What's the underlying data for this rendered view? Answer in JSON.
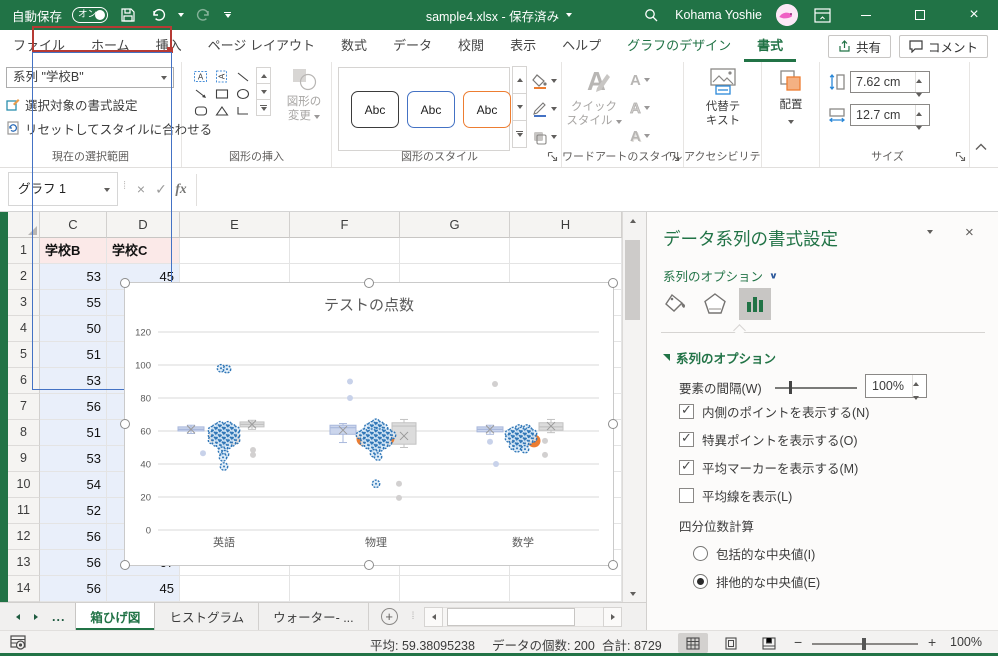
{
  "titlebar": {
    "autosave_label": "自動保存",
    "autosave_state": "オン",
    "title": "sample4.xlsx - 保存済み",
    "user": "Kohama Yoshie"
  },
  "ribbon_tabs": [
    {
      "label": "ファイル",
      "ctx": false,
      "active": false
    },
    {
      "label": "ホーム",
      "ctx": false,
      "active": false
    },
    {
      "label": "挿入",
      "ctx": false,
      "active": false
    },
    {
      "label": "ページ レイアウト",
      "ctx": false,
      "active": false
    },
    {
      "label": "数式",
      "ctx": false,
      "active": false
    },
    {
      "label": "データ",
      "ctx": false,
      "active": false
    },
    {
      "label": "校閲",
      "ctx": false,
      "active": false
    },
    {
      "label": "表示",
      "ctx": false,
      "active": false
    },
    {
      "label": "ヘルプ",
      "ctx": false,
      "active": false
    },
    {
      "label": "グラフのデザイン",
      "ctx": true,
      "active": false
    },
    {
      "label": "書式",
      "ctx": true,
      "active": true
    }
  ],
  "topbar_buttons": {
    "share": "共有",
    "comment": "コメント"
  },
  "ribbon": {
    "current_selection": {
      "label": "現在の選択範囲",
      "dropdown": "系列 \"学校B\"",
      "format_selection": "選択対象の書式設定",
      "reset": "リセットしてスタイルに合わせる"
    },
    "insert_shapes": {
      "label": "図形の挿入",
      "change_l1": "図形の",
      "change_l2": "変更"
    },
    "shape_styles": {
      "label": "図形のスタイル",
      "samples": [
        "Abc",
        "Abc",
        "Abc"
      ]
    },
    "wordart": {
      "label": "ワードアートのスタイル",
      "quick_l1": "クイック",
      "quick_l2": "スタイル"
    },
    "accessibility": {
      "label": "アクセシビリティ",
      "alt_l1": "代替テ",
      "alt_l2": "キスト"
    },
    "arrange": {
      "label": "配置"
    },
    "size": {
      "label": "サイズ",
      "height": "7.62 cm",
      "width": "12.7 cm"
    }
  },
  "formula_bar": {
    "name_box": "グラフ 1",
    "fx": "fx",
    "formula": ""
  },
  "grid": {
    "columns": [
      "C",
      "D",
      "E",
      "F",
      "G",
      "H"
    ],
    "rows": [
      {
        "n": "1",
        "c": "学校B",
        "d": "学校C",
        "header": true
      },
      {
        "n": "2",
        "c": "53",
        "d": "45"
      },
      {
        "n": "3",
        "c": "55",
        "d": ""
      },
      {
        "n": "4",
        "c": "50",
        "d": ""
      },
      {
        "n": "5",
        "c": "51",
        "d": ""
      },
      {
        "n": "6",
        "c": "53",
        "d": ""
      },
      {
        "n": "7",
        "c": "56",
        "d": ""
      },
      {
        "n": "8",
        "c": "51",
        "d": ""
      },
      {
        "n": "9",
        "c": "53",
        "d": ""
      },
      {
        "n": "10",
        "c": "54",
        "d": ""
      },
      {
        "n": "11",
        "c": "52",
        "d": ""
      },
      {
        "n": "12",
        "c": "56",
        "d": ""
      },
      {
        "n": "13",
        "c": "56",
        "d": "67"
      },
      {
        "n": "14",
        "c": "56",
        "d": "45"
      }
    ]
  },
  "chart": {
    "type": "box",
    "title": "テストの点数",
    "categories": [
      "英語",
      "物理",
      "数学"
    ],
    "ylim": [
      0,
      120
    ],
    "yticks": [
      0,
      20,
      40,
      60,
      80,
      100,
      120
    ],
    "series": [
      {
        "id": "a",
        "kind": "box",
        "fill": "#cbd5ec",
        "stroke": "#a9b8dc",
        "boxes": [
          {
            "lo": 58.5,
            "q1": 60,
            "med": 61,
            "q3": 62.5,
            "hi": 63.5,
            "mean": 61
          },
          {
            "lo": 53,
            "q1": 58,
            "med": 62,
            "q3": 63.5,
            "hi": 64.5,
            "mean": 60.5
          },
          {
            "lo": 58,
            "q1": 59.5,
            "med": 61,
            "q3": 62.5,
            "hi": 63.5,
            "mean": 61
          }
        ],
        "outliers": [
          [
            [
              -21,
              46.5
            ]
          ],
          [
            [
              -26,
              90
            ],
            [
              -26,
              80
            ]
          ],
          [
            [
              -33,
              53.5
            ],
            [
              -27,
              40
            ]
          ]
        ]
      },
      {
        "id": "b",
        "label": "学校B",
        "kind": "points",
        "selected": true,
        "ring": "#2e75b6",
        "fill": "#dcebf8",
        "mean_color": "#ed7d31",
        "clusters": [
          [
            [
              -3,
              98
            ],
            [
              3,
              97.5
            ],
            [
              -4,
              63.5
            ],
            [
              4,
              63.5
            ],
            [
              -8,
              62
            ],
            [
              0,
              62
            ],
            [
              8,
              62
            ],
            [
              -12,
              60.5
            ],
            [
              -4,
              60.5
            ],
            [
              4,
              60.5
            ],
            [
              12,
              60.5
            ],
            [
              -8,
              59
            ],
            [
              0,
              59
            ],
            [
              8,
              59
            ],
            [
              -12,
              57.5
            ],
            [
              -4,
              57.5
            ],
            [
              4,
              57.5
            ],
            [
              12,
              57.5
            ],
            [
              -8,
              56
            ],
            [
              0,
              56
            ],
            [
              8,
              56
            ],
            [
              -12,
              54.5
            ],
            [
              -4,
              54.5
            ],
            [
              4,
              54.5
            ],
            [
              12,
              54.5
            ],
            [
              -8,
              53
            ],
            [
              0,
              53
            ],
            [
              8,
              53
            ],
            [
              -4,
              51.5
            ],
            [
              4,
              51.5
            ],
            [
              0,
              50
            ],
            [
              -2,
              48
            ],
            [
              1,
              46
            ],
            [
              -1,
              44
            ],
            [
              0,
              38.5
            ]
          ],
          [
            [
              0,
              65
            ],
            [
              -4,
              63.5
            ],
            [
              4,
              63.5
            ],
            [
              -8,
              62
            ],
            [
              0,
              62
            ],
            [
              8,
              62
            ],
            [
              -4,
              60.5
            ],
            [
              4,
              60.5
            ],
            [
              -12,
              59
            ],
            [
              -4,
              59
            ],
            [
              4,
              59
            ],
            [
              12,
              59
            ],
            [
              -16,
              57.5
            ],
            [
              -8,
              57.5
            ],
            [
              0,
              57.5
            ],
            [
              8,
              57.5
            ],
            [
              16,
              57.5
            ],
            [
              -12,
              56
            ],
            [
              -4,
              56
            ],
            [
              4,
              56
            ],
            [
              12,
              56
            ],
            [
              -8,
              54.5
            ],
            [
              0,
              54.5
            ],
            [
              8,
              54.5
            ],
            [
              -12,
              53
            ],
            [
              -4,
              53
            ],
            [
              4,
              53
            ],
            [
              12,
              53
            ],
            [
              -8,
              51.5
            ],
            [
              0,
              51.5
            ],
            [
              8,
              51.5
            ],
            [
              -4,
              50
            ],
            [
              4,
              50
            ],
            [
              0,
              48.5
            ],
            [
              -2,
              46.5
            ],
            [
              2,
              44.5
            ],
            [
              0,
              28
            ]
          ],
          [
            [
              -4,
              61.5
            ],
            [
              4,
              61.5
            ],
            [
              -10,
              60
            ],
            [
              -2,
              60
            ],
            [
              6,
              60
            ],
            [
              -14,
              58.5
            ],
            [
              -6,
              58.5
            ],
            [
              2,
              58.5
            ],
            [
              10,
              58.5
            ],
            [
              -10,
              57
            ],
            [
              -2,
              57
            ],
            [
              6,
              57
            ],
            [
              -14,
              55.5
            ],
            [
              -6,
              55.5
            ],
            [
              2,
              55.5
            ],
            [
              10,
              55.5
            ],
            [
              -10,
              54
            ],
            [
              -2,
              54
            ],
            [
              6,
              54
            ],
            [
              -6,
              52.5
            ],
            [
              2,
              52.5
            ],
            [
              -10,
              51
            ],
            [
              -2,
              51
            ],
            [
              -6,
              49.5
            ],
            [
              2,
              49
            ]
          ]
        ],
        "means": [
          [
            [
              -9,
              56.5
            ],
            [
              2,
              57.5
            ],
            [
              9,
              55.5
            ]
          ],
          [
            [
              -13,
              55
            ],
            [
              0,
              53.5
            ],
            [
              12,
              55.5
            ]
          ],
          [
            [
              -8,
              55
            ],
            [
              4,
              56
            ],
            [
              11,
              54
            ]
          ]
        ]
      },
      {
        "id": "c",
        "label": "学校C",
        "kind": "box",
        "fill": "#dcdcdc",
        "stroke": "#c2c2c2",
        "boxes": [
          {
            "lo": 61,
            "q1": 62.5,
            "med": 64,
            "q3": 65.5,
            "hi": 66.5,
            "mean": 64
          },
          {
            "lo": 50,
            "q1": 52,
            "med": 63,
            "q3": 65,
            "hi": 67,
            "mean": 57
          },
          {
            "lo": 59,
            "q1": 60.5,
            "med": 62.5,
            "q3": 65,
            "hi": 67,
            "mean": 63
          }
        ],
        "outliers": [
          [
            [
              29,
              48.5
            ],
            [
              29,
              45.5
            ]
          ],
          [
            [
              23,
              28
            ],
            [
              23,
              19.5
            ]
          ],
          [
            [
              -28,
              88.5
            ],
            [
              22,
              54
            ],
            [
              22,
              45.5
            ]
          ]
        ]
      }
    ]
  },
  "pane": {
    "title": "データ系列の書式設定",
    "section": "系列のオプション",
    "options_header": "系列のオプション",
    "gap_label": "要素の間隔(W)",
    "gap_value": "100%",
    "checkboxes": [
      {
        "label": "内側のポイントを表示する(N)",
        "checked": true
      },
      {
        "label": "特異ポイントを表示する(O)",
        "checked": true
      },
      {
        "label": "平均マーカーを表示する(M)",
        "checked": true
      },
      {
        "label": "平均線を表示(L)",
        "checked": false
      }
    ],
    "quartile_label": "四分位数計算",
    "radios": [
      {
        "label": "包括的な中央値(I)",
        "selected": false
      },
      {
        "label": "排他的な中央値(E)",
        "selected": true
      }
    ]
  },
  "sheet_tabs": {
    "tabs": [
      {
        "label": "箱ひげ図",
        "active": true
      },
      {
        "label": "ヒストグラム",
        "active": false
      },
      {
        "label": "ウォーター- ...",
        "active": false
      }
    ]
  },
  "status_bar": {
    "average": "平均: 59.38095238",
    "count": "データの個数: 200",
    "sum": "合計: 8729",
    "zoom": "100%"
  },
  "colors": {
    "green": "#217346",
    "accent_blue": "#4472c4",
    "orange": "#ed7d31",
    "red_border": "#b63a34"
  }
}
